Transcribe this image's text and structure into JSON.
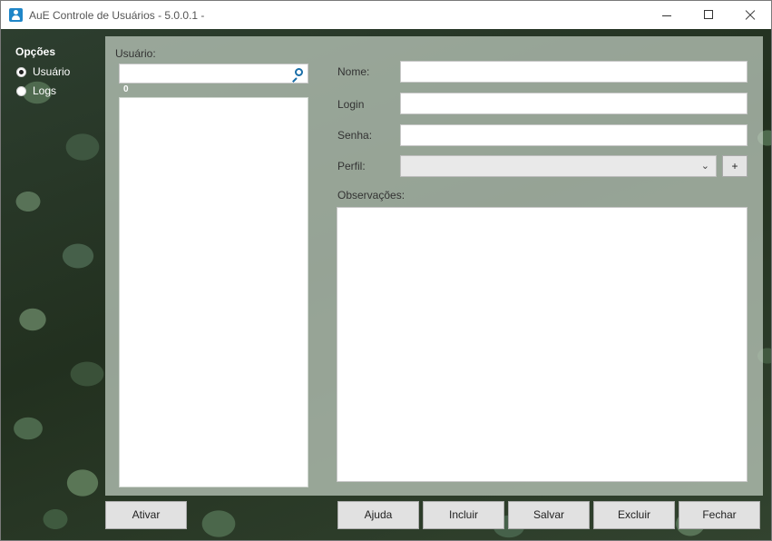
{
  "window": {
    "title": "AuE Controle de Usuários - 5.0.0.1 -"
  },
  "sidebar": {
    "title": "Opções",
    "options": [
      {
        "label": "Usuário",
        "checked": true
      },
      {
        "label": "Logs",
        "checked": false
      }
    ]
  },
  "user_panel": {
    "label": "Usuário:",
    "search_value": "",
    "count": "0",
    "items": []
  },
  "form": {
    "nome_label": "Nome:",
    "nome_value": "",
    "login_label": "Login",
    "login_value": "",
    "senha_label": "Senha:",
    "senha_value": "",
    "perfil_label": "Perfil:",
    "perfil_value": "",
    "perfil_add": "+",
    "obs_label": "Observações:",
    "obs_value": ""
  },
  "buttons": {
    "ativar": "Ativar",
    "ajuda": "Ajuda",
    "incluir": "Incluir",
    "salvar": "Salvar",
    "excluir": "Excluir",
    "fechar": "Fechar"
  },
  "icons": {
    "app": "user-shield-icon",
    "search": "search-icon",
    "dropdown": "chevron-down-icon"
  },
  "colors": {
    "accent": "#1f86c8",
    "panel_overlay": "#c4d0c4"
  }
}
